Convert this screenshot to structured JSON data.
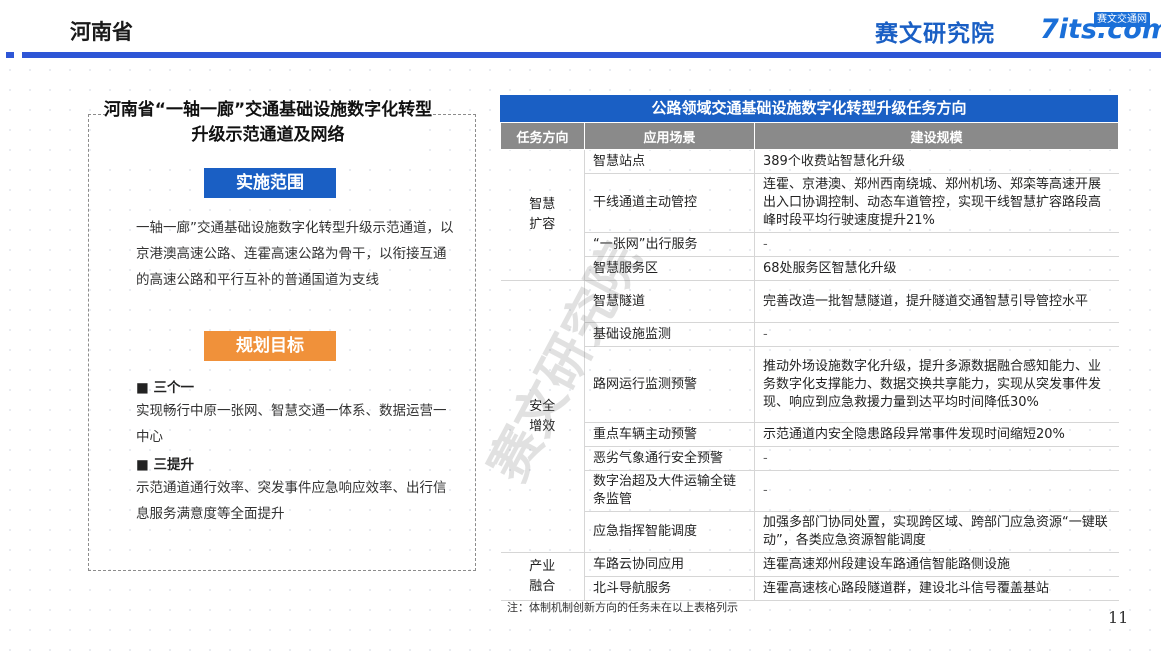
{
  "header": {
    "page_title": "河南省",
    "brand_name": "赛文研究院",
    "logo_text": "7its.com",
    "logo_badge": "赛文交通网",
    "accent_color": "#2e56d6"
  },
  "left_panel": {
    "title": "河南省“一轴一廊”交通基础设施数字化转型升级示范通道及网络",
    "scope_label": "实施范围",
    "scope_text": "一轴一廊”交通基础设施数字化转型升级示范通道，以京港澳高速公路、连霍高速公路为骨干，以衔接互通的高速公路和平行互补的普通国道为支线",
    "goals_label": "规划目标",
    "goal1_title": "■ 三个一",
    "goal1_text": "实现畅行中原一张网、智慧交通一体系、数据运营一中心",
    "goal2_title": "■ 三提升",
    "goal2_text": "示范通道通行效率、突发事件应急响应效率、出行信息服务满意度等全面提升"
  },
  "table": {
    "title": "公路领域交通基础设施数字化转型升级任务方向",
    "headers": [
      "任务方向",
      "应用场景",
      "建设规模"
    ],
    "groups": [
      {
        "direction": "智慧\n扩容",
        "rows": [
          {
            "scene": "智慧站点",
            "scale": "389个收费站智慧化升级"
          },
          {
            "scene": "干线通道主动管控",
            "scale": "连霍、京港澳、郑州西南绕城、郑州机场、郑栾等高速开展出入口协调控制、动态车道管控，实现干线智慧扩容路段高峰时段平均行驶速度提升21%"
          },
          {
            "scene": "“一张网”出行服务",
            "scale": "-"
          },
          {
            "scene": "智慧服务区",
            "scale": "68处服务区智慧化升级"
          }
        ]
      },
      {
        "direction": "安全\n增效",
        "rows": [
          {
            "scene": "智慧隧道",
            "scale": "完善改造一批智慧隧道，提升隧道交通智慧引导管控水平"
          },
          {
            "scene": "基础设施监测",
            "scale": "-"
          },
          {
            "scene": "路网运行监测预警",
            "scale": "推动外场设施数字化升级，提升多源数据融合感知能力、业务数字化支撑能力、数据交换共享能力，实现从突发事件发现、响应到应急救援力量到达平均时间降低30%"
          },
          {
            "scene": "重点车辆主动预警",
            "scale": "示范通道内安全隐患路段异常事件发现时间缩短20%"
          },
          {
            "scene": "恶劣气象通行安全预警",
            "scale": "-"
          },
          {
            "scene": "数字治超及大件运输全链条监管",
            "scale": "-"
          },
          {
            "scene": "应急指挥智能调度",
            "scale": "加强多部门协同处置，实现跨区域、跨部门应急资源“一键联动”，各类应急资源智能调度"
          }
        ]
      },
      {
        "direction": "产业\n融合",
        "rows": [
          {
            "scene": "车路云协同应用",
            "scale": "连霍高速郑州段建设车路通信智能路侧设施"
          },
          {
            "scene": "北斗导航服务",
            "scale": "连霍高速核心路段隧道群，建设北斗信号覆盖基站"
          }
        ]
      }
    ]
  },
  "note": "注：体制机制创新方向的任务未在以上表格列示",
  "watermark": "赛文研究院",
  "page_number": "11"
}
